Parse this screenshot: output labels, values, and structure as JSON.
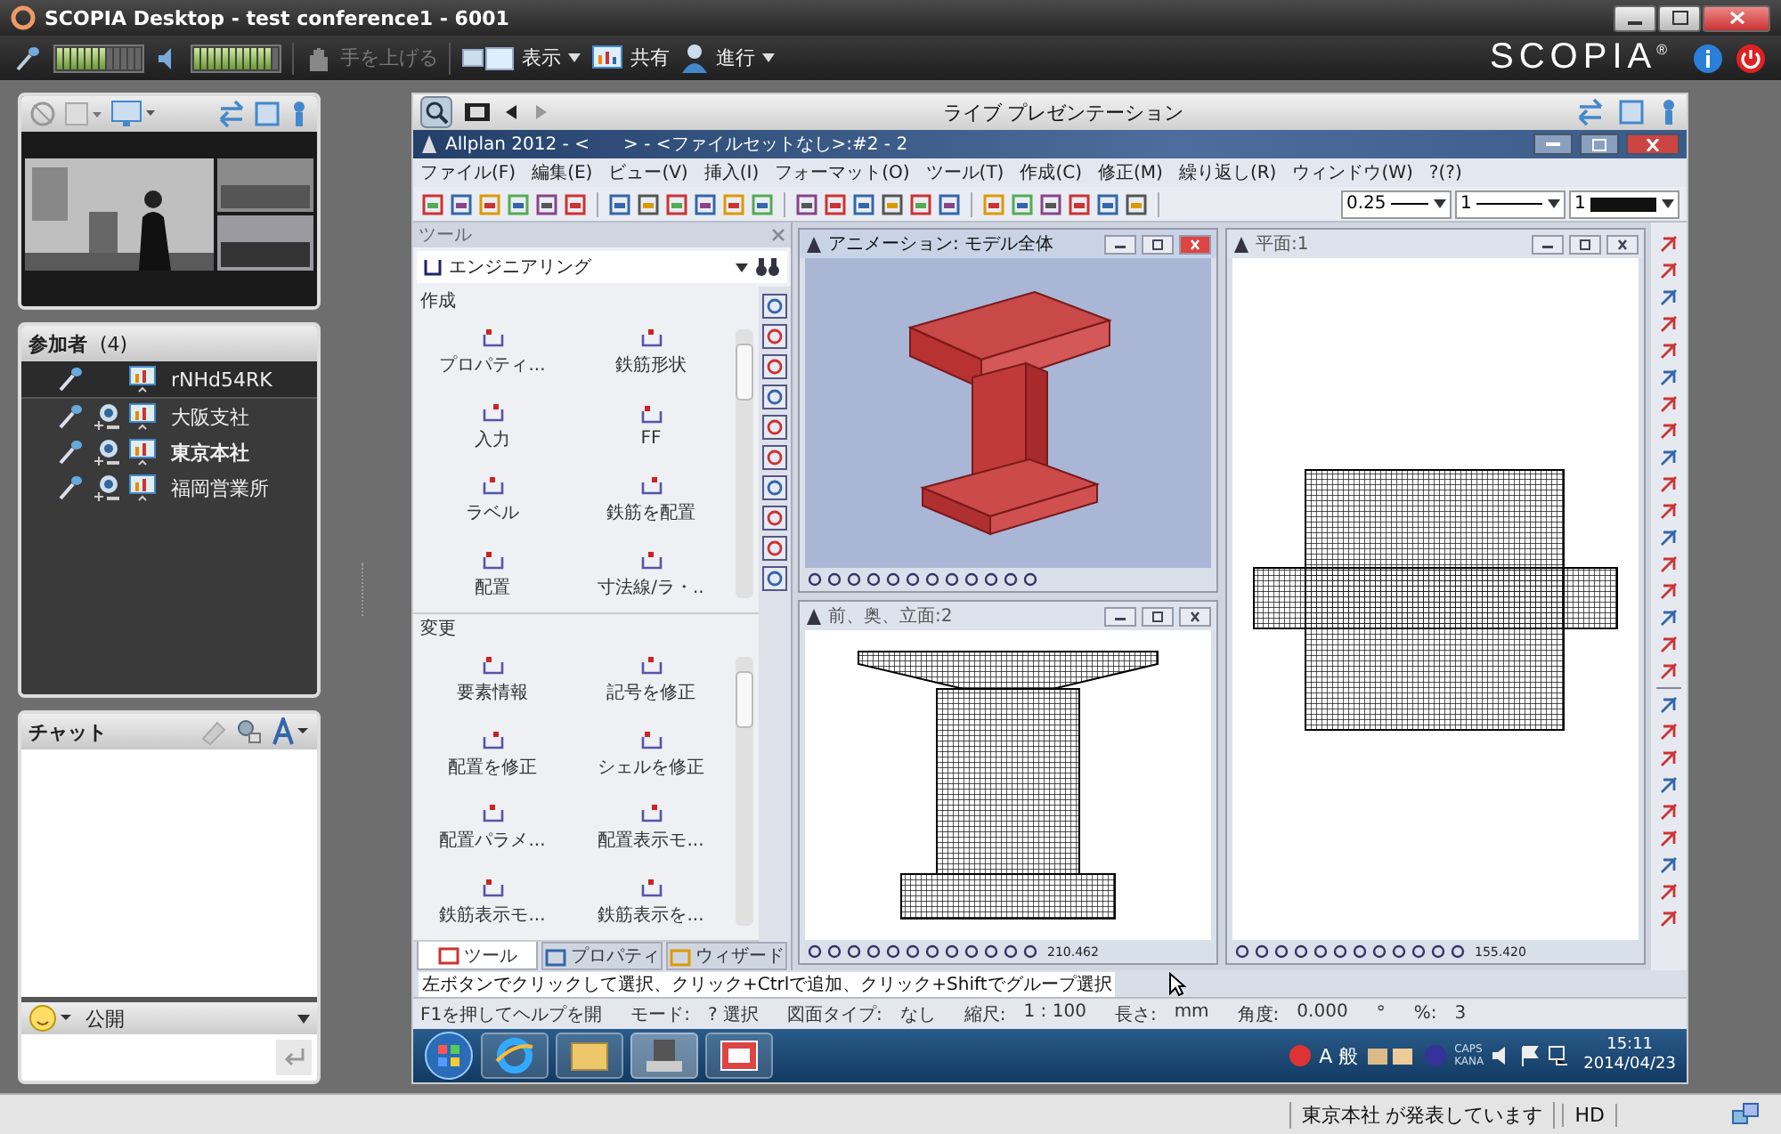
{
  "window": {
    "title": "SCOPIA Desktop - test conference1 - 6001"
  },
  "toolbar": {
    "mic": {
      "level": 0.6
    },
    "speaker": {
      "level": 0.9
    },
    "raise_hand": {
      "label": "手を上げる",
      "disabled": true
    },
    "view": "表示",
    "share": "共有",
    "progress": "進行",
    "logo": "SCOPIA",
    "logo_mark": "®"
  },
  "participants": {
    "title": "参加者",
    "count": "(4)",
    "items": [
      {
        "name": "rNHd54RK",
        "selected": true,
        "camera": false,
        "presenting": false
      },
      {
        "name": "大阪支社",
        "selected": false,
        "camera": true,
        "presenting": false
      },
      {
        "name": "東京本社",
        "selected": false,
        "camera": true,
        "presenting": true
      },
      {
        "name": "福岡営業所",
        "selected": false,
        "camera": true,
        "presenting": false
      }
    ]
  },
  "chat": {
    "title": "チャット",
    "audience": "公開"
  },
  "presentation": {
    "title": "ライブ プレゼンテーション",
    "app": {
      "title": "Allplan 2012 - <      > - <ファイルセットなし>:#2 - 2",
      "menu": [
        "ファイル(F)",
        "編集(E)",
        "ビュー(V)",
        "挿入(I)",
        "フォーマット(O)",
        "ツール(T)",
        "作成(C)",
        "修正(M)",
        "繰り返し(R)",
        "ウィンドウ(W)",
        "?(?)"
      ],
      "pen": "0.25",
      "line": "1",
      "color": {
        "label": "1",
        "color": "#111111"
      },
      "tools": {
        "title": "ツール",
        "category": "エンジニアリング",
        "sections": [
          {
            "title": "作成",
            "items": [
              "プロパティ...",
              "鉄筋形状",
              "入力",
              "FF",
              "ラベル",
              "鉄筋を配置",
              "配置",
              "寸法線/ラ・.."
            ]
          },
          {
            "title": "変更",
            "items": [
              "要素情報",
              "記号を修正",
              "配置を修正",
              "シェルを修正",
              "配置パラメ...",
              "配置表示モ...",
              "鉄筋表示モ...",
              "鉄筋表示を..."
            ]
          }
        ],
        "tabs": [
          {
            "label": "ツール",
            "selected": true
          },
          {
            "label": "プロパティ",
            "selected": false
          },
          {
            "label": "ウィザード",
            "selected": false
          }
        ]
      },
      "viewports": [
        {
          "title": "アニメーション: モデル全体",
          "kind": "model3d",
          "active": true
        },
        {
          "title": "前、奥、立面:2",
          "kind": "elevation",
          "active": false,
          "scale": "210.462"
        },
        {
          "title": "平面:1",
          "kind": "plan",
          "active": false,
          "scale": "155.420"
        }
      ],
      "hint": "左ボタンでクリックして選択、クリック+Ctrlで追加、クリック+Shiftでグループ選択",
      "status": [
        {
          "label": "F1を押してヘルプを開"
        },
        {
          "label": "モード:",
          "value": "? 選択"
        },
        {
          "label": "図面タイプ:",
          "value": "なし"
        },
        {
          "label": "縮尺:",
          "value": "1 : 100"
        },
        {
          "label": "長さ:",
          "value": "mm"
        },
        {
          "label": "角度:",
          "value": "0.000"
        },
        {
          "label": "°"
        },
        {
          "label": "%:",
          "value": "3"
        }
      ],
      "taskbar": {
        "ime": "A 般",
        "caps": "CAPS",
        "kana": "KANA",
        "time": "15:11",
        "date": "2014/04/23"
      }
    }
  },
  "status_bar": {
    "message": "東京本社 が発表しています",
    "quality": "HD"
  }
}
